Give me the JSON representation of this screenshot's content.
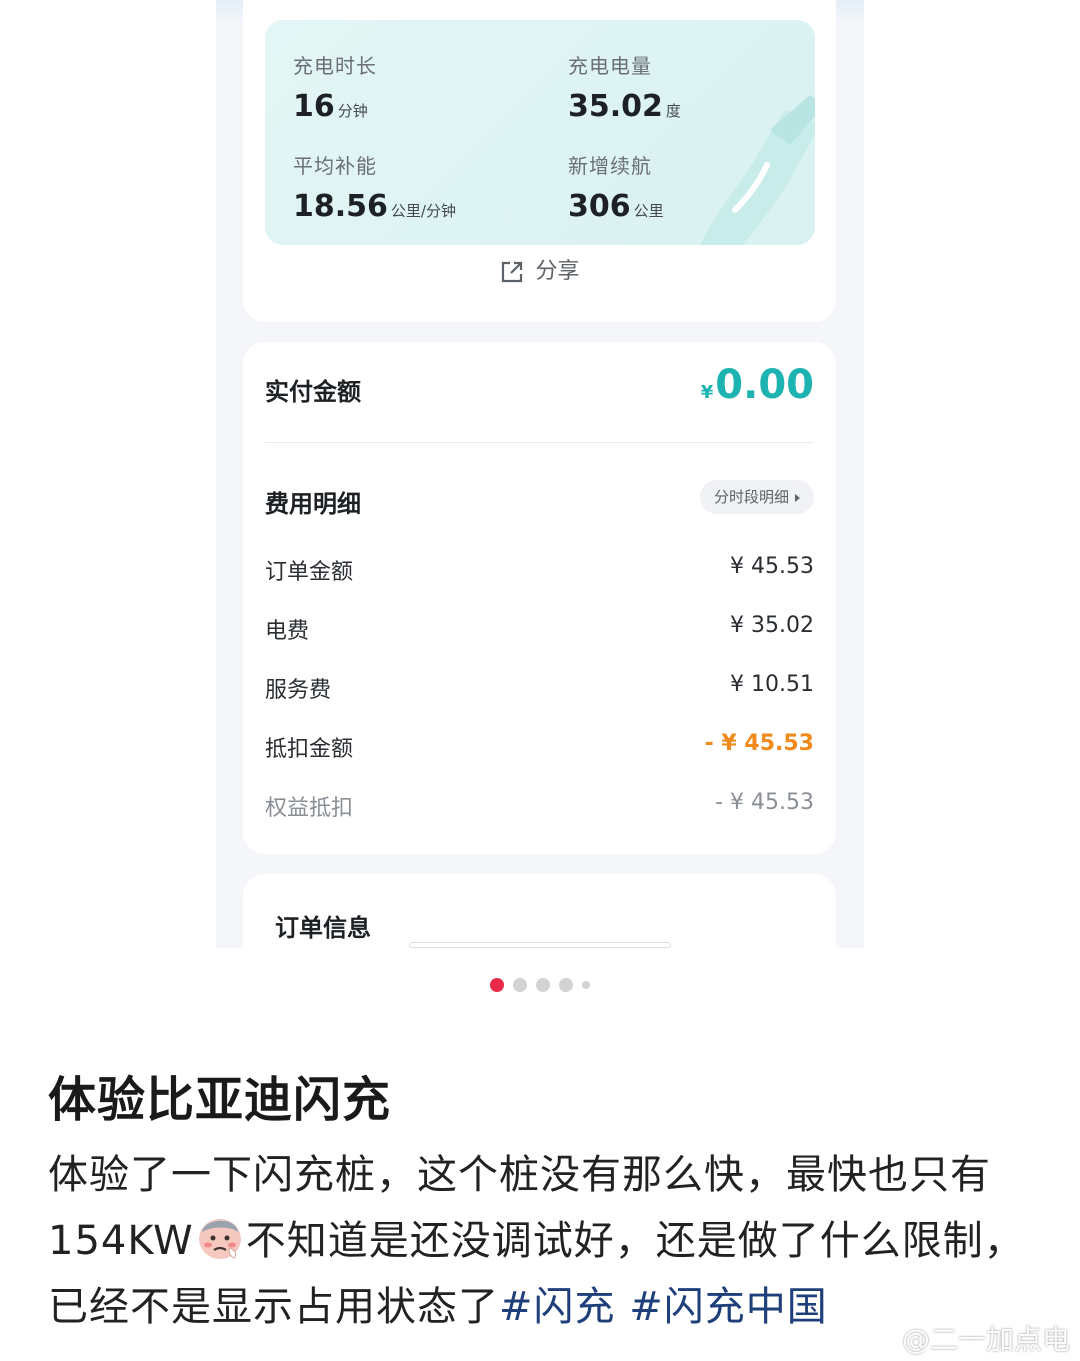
{
  "charging": {
    "stats": [
      {
        "label": "充电时长",
        "value": "16",
        "unit": "分钟"
      },
      {
        "label": "充电电量",
        "value": "35.02",
        "unit": "度"
      },
      {
        "label": "平均补能",
        "value": "18.56",
        "unit": "公里/分钟"
      },
      {
        "label": "新增续航",
        "value": "306",
        "unit": "公里"
      }
    ],
    "share_label": "分享",
    "share_icon": "share-icon"
  },
  "payment": {
    "label": "实付金额",
    "currency": "¥",
    "amount": "0.00",
    "accent_color": "#1cb3b0"
  },
  "fees": {
    "title": "费用明细",
    "period_button": "分时段明细",
    "rows": [
      {
        "name": "订单金额",
        "value": "¥ 45.53"
      },
      {
        "name": "电费",
        "value": "¥ 35.02"
      },
      {
        "name": "服务费",
        "value": "¥ 10.51"
      },
      {
        "name": "抵扣金额",
        "value": "- ¥ 45.53"
      },
      {
        "name": "权益抵扣",
        "value": "- ¥ 45.53"
      }
    ],
    "deduct_color": "#f08a1c"
  },
  "order": {
    "label": "订单信息"
  },
  "carousel": {
    "total_dots": 5,
    "active_index": 0,
    "active_color": "#e8294a"
  },
  "post": {
    "title": "体验比亚迪闪充",
    "body_part1": "体验了一下闪充桩，这个桩没有那么快，最快也只有154KW",
    "emoji": "sweating-face-emoji",
    "body_part2": "不知道是还没调试好，还是做了什么限制，已经不是显示占用状态了",
    "hashtag1": "#闪充",
    "hashtag2": "#闪充中国"
  },
  "watermark": {
    "text": "@二一加点电",
    "logo": "weibo-logo-icon"
  }
}
